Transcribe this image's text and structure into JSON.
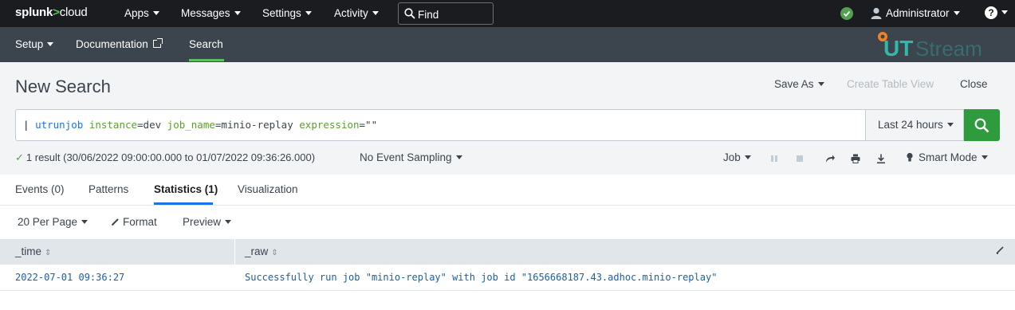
{
  "topbar": {
    "logo": {
      "part1": "splunk",
      "part2": ">",
      "part3": "cloud"
    },
    "menus": [
      {
        "label": "Apps"
      },
      {
        "label": "Messages"
      },
      {
        "label": "Settings"
      },
      {
        "label": "Activity"
      }
    ],
    "find_placeholder": "Find",
    "user": "Administrator",
    "help_glyph": "?"
  },
  "appbar": {
    "items": [
      {
        "label": "Setup"
      },
      {
        "label": "Documentation"
      },
      {
        "label": "Search"
      }
    ],
    "app_logo": {
      "text_ut": "UT",
      "text_stream": "Stream"
    }
  },
  "header": {
    "title": "New Search",
    "save_as": "Save As",
    "create_table_view": "Create Table View",
    "close": "Close"
  },
  "search": {
    "pipe": "|",
    "command": "utrunjob",
    "arg1_key": "instance",
    "arg1_val": "=dev",
    "arg2_key": "job_name",
    "arg2_val": "=minio-replay",
    "arg3_key": "expression",
    "arg3_val": "=\"\"",
    "time_range": "Last 24 hours"
  },
  "status": {
    "check": "✓",
    "result_text": "1 result (30/06/2022 09:00:00.000 to 01/07/2022 09:36:26.000)",
    "sampling": "No Event Sampling",
    "job": "Job",
    "mode": "Smart Mode"
  },
  "tabs": [
    {
      "label": "Events (0)"
    },
    {
      "label": "Patterns"
    },
    {
      "label": "Statistics (1)"
    },
    {
      "label": "Visualization"
    }
  ],
  "table_controls": {
    "per_page": "20 Per Page",
    "format": "Format",
    "preview": "Preview"
  },
  "table": {
    "columns": [
      {
        "label": "_time",
        "sort": "⇕"
      },
      {
        "label": "_raw",
        "sort": "⇕"
      }
    ],
    "rows": [
      {
        "time": "2022-07-01 09:36:27",
        "raw": "Successfully run job \"minio-replay\" with job id \"1656668187.43.adhoc.minio-replay\""
      }
    ]
  },
  "colors": {
    "topbar_bg": "#1a1c20",
    "appbar_bg": "#3c444d",
    "accent_green": "#5cc05c",
    "search_button": "#2e9b3c",
    "tab_active": "#1a73e8",
    "app_logo_teal": "#2fb9a6",
    "app_logo_orange": "#f58220"
  }
}
